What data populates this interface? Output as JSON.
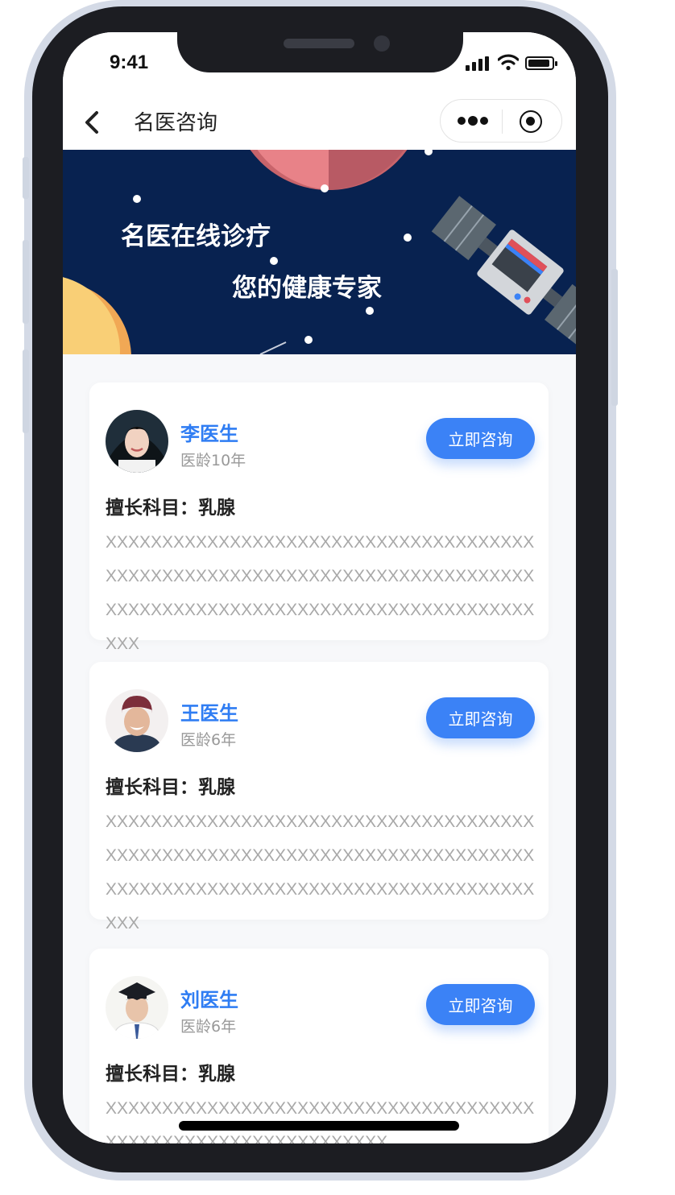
{
  "status_bar": {
    "time": "9:41"
  },
  "nav": {
    "title": "名医咨询"
  },
  "banner": {
    "line1": "名医在线诊疗",
    "line2": "您的健康专家"
  },
  "colors": {
    "accent": "#3b82f6",
    "name_blue": "#2f7df3",
    "banner_bg": "#082250"
  },
  "doctors": [
    {
      "name": "李医生",
      "experience": "医龄10年",
      "button_label": "立即咨询",
      "specialty": "擅长科目：乳腺",
      "description": "XXXXXXXXXXXXXXXXXXXXXXXXXXXXXXXXXXXXXXXXXXXXXXXXXXXXXXXXXXXXXXXXXXXXXXXXXXXXXXXXXXXXXXXXXXXXXXXXXXXXXXXXXXXXXXXXXXXXX"
    },
    {
      "name": "王医生",
      "experience": "医龄6年",
      "button_label": "立即咨询",
      "specialty": "擅长科目：乳腺",
      "description": "XXXXXXXXXXXXXXXXXXXXXXXXXXXXXXXXXXXXXXXXXXXXXXXXXXXXXXXXXXXXXXXXXXXXXXXXXXXXXXXXXXXXXXXXXXXXXXXXXXXXXXXXXXXXXXXXXXXXX"
    },
    {
      "name": "刘医生",
      "experience": "医龄6年",
      "button_label": "立即咨询",
      "specialty": "擅长科目：乳腺",
      "description": "XXXXXXXXXXXXXXXXXXXXXXXXXXXXXXXXXXXXXXXXXXXXXXXXXXXXXXXXXXXXXXX"
    }
  ]
}
